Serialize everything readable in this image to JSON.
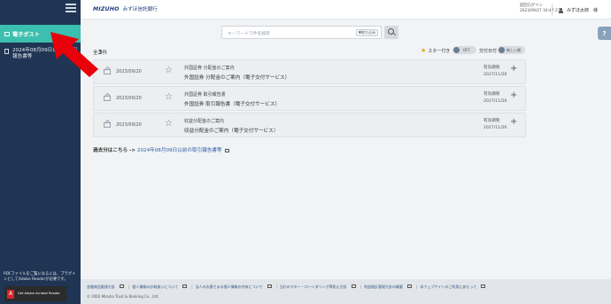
{
  "sidebar": {
    "active_item": "電子ポスト",
    "item_2": "2024年08月09日以前の取引報告書等",
    "note": "PDFファイルをご覧になるには、プラグインとしてAdobe Readerが必要です。",
    "reader_label": "Get Adobe Acrobat Reader"
  },
  "header": {
    "brand_en": "MIZUHO",
    "brand_ja": "みずほ信託銀行",
    "login_label": "前回ログイン",
    "login_time": "2023/09/27 16:47:27",
    "user_name": "みずほ太郎　様"
  },
  "search": {
    "placeholder": "キーワードで件名検索",
    "filter_label": "▼絞り込み"
  },
  "list": {
    "count_prefix": "全",
    "count": "3",
    "count_suffix": "件",
    "star_label": "スター付き",
    "toggle_off": "OFF",
    "date_label": "交付日付",
    "sort_label": "新しい順"
  },
  "rows": [
    {
      "date": "2023/09/20",
      "title": "外国証券 分配金のご案内",
      "subtitle": "外国証券 分配金のご案内（電子交付サービス）",
      "expiry_label": "有効期限",
      "expiry": "2027/11/26"
    },
    {
      "date": "2023/09/20",
      "title": "外国証券 取引報告書",
      "subtitle": "外国証券 取引報告書（電子交付サービス）",
      "expiry_label": "有効期限",
      "expiry": "2027/11/26"
    },
    {
      "date": "2023/09/20",
      "title": "収益分配金のご案内",
      "subtitle": "収益分配金のご案内（電子交付サービス）",
      "expiry_label": "有効期限",
      "expiry": "2027/11/26"
    }
  ],
  "past": {
    "prefix": "過去分はこちら ->",
    "link": "2024年08月09日以前の取引報告書等"
  },
  "footer": {
    "links": [
      "金融商品勧誘方針",
      "個人情報のお取扱いについて",
      "法人のお客さまの個人情報の共有について",
      "当行のマネー・ローンダリング等防止方針",
      "利益相反管理方針の概要",
      "本ウェブサイトのご利用にあたって"
    ],
    "copyright": "© 2002 Mizuho Trust & Banking Co., Ltd."
  },
  "colors": {
    "sidebar": "#1f3553",
    "accent": "#3bbfae",
    "annotation": "#e8000b"
  }
}
